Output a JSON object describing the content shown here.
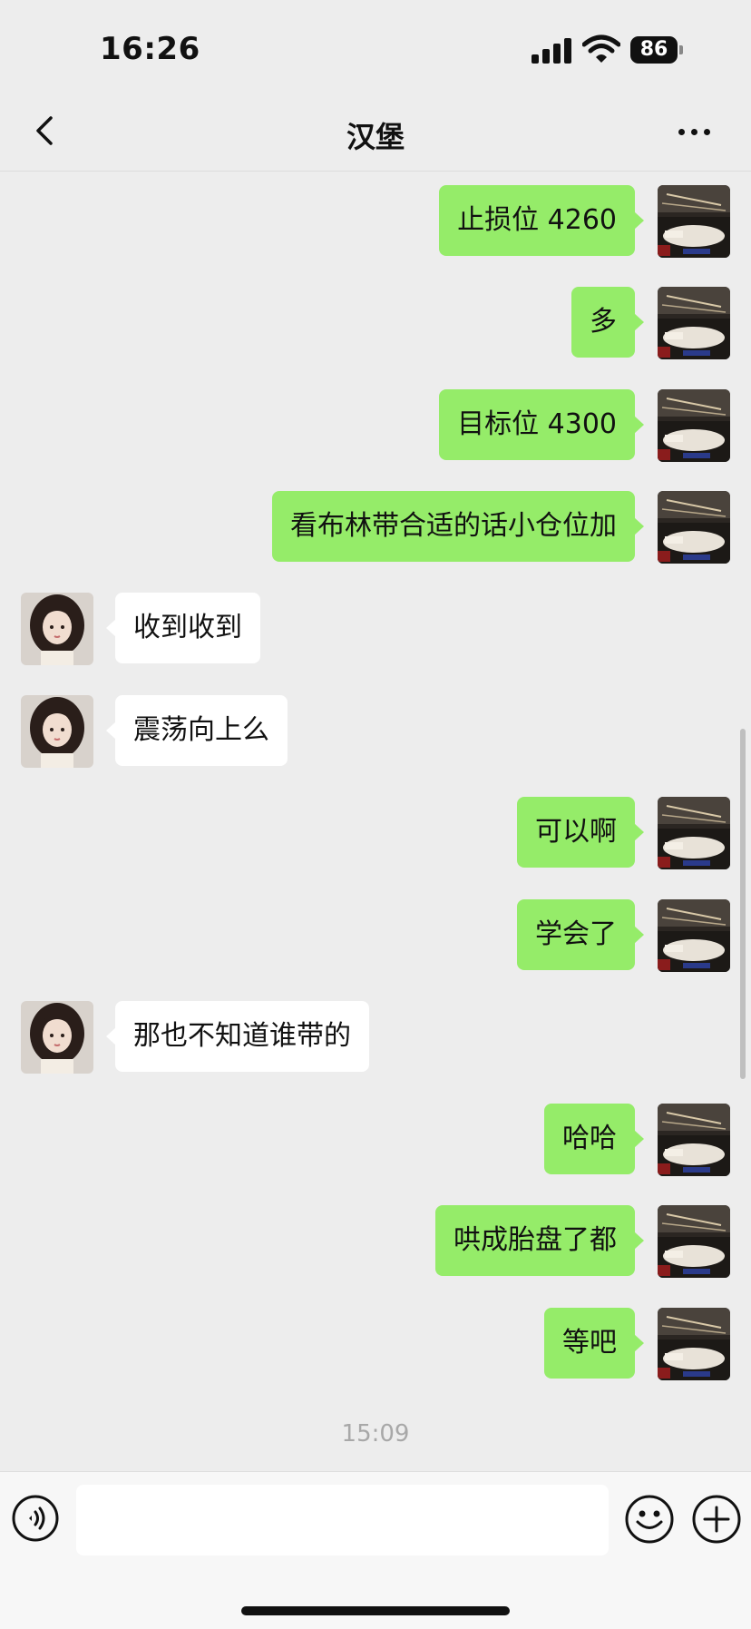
{
  "status_bar": {
    "time": "16:26",
    "battery": "86"
  },
  "header": {
    "title": "汉堡"
  },
  "messages": [
    {
      "from": "self",
      "text": "止损位 4260"
    },
    {
      "from": "self",
      "text": "多"
    },
    {
      "from": "self",
      "text": "目标位 4300"
    },
    {
      "from": "self",
      "text": "看布林带合适的话小仓位加"
    },
    {
      "from": "other",
      "text": "收到收到"
    },
    {
      "from": "other",
      "text": "震荡向上么"
    },
    {
      "from": "self",
      "text": "可以啊"
    },
    {
      "from": "self",
      "text": "学会了"
    },
    {
      "from": "other",
      "text": "那也不知道谁带的"
    },
    {
      "from": "self",
      "text": "哈哈"
    },
    {
      "from": "self",
      "text": "哄成胎盘了都"
    },
    {
      "from": "self",
      "text": "等吧"
    }
  ],
  "timestamp": "15:09",
  "input": {
    "value": "",
    "placeholder": ""
  },
  "icons": {
    "back": "chevron-left-icon",
    "more": "more-dots-icon",
    "voice": "voice-icon",
    "emoji": "emoji-icon",
    "plus": "plus-icon"
  },
  "colors": {
    "self_bubble": "#95ec69",
    "other_bubble": "#ffffff",
    "background": "#ededed"
  }
}
